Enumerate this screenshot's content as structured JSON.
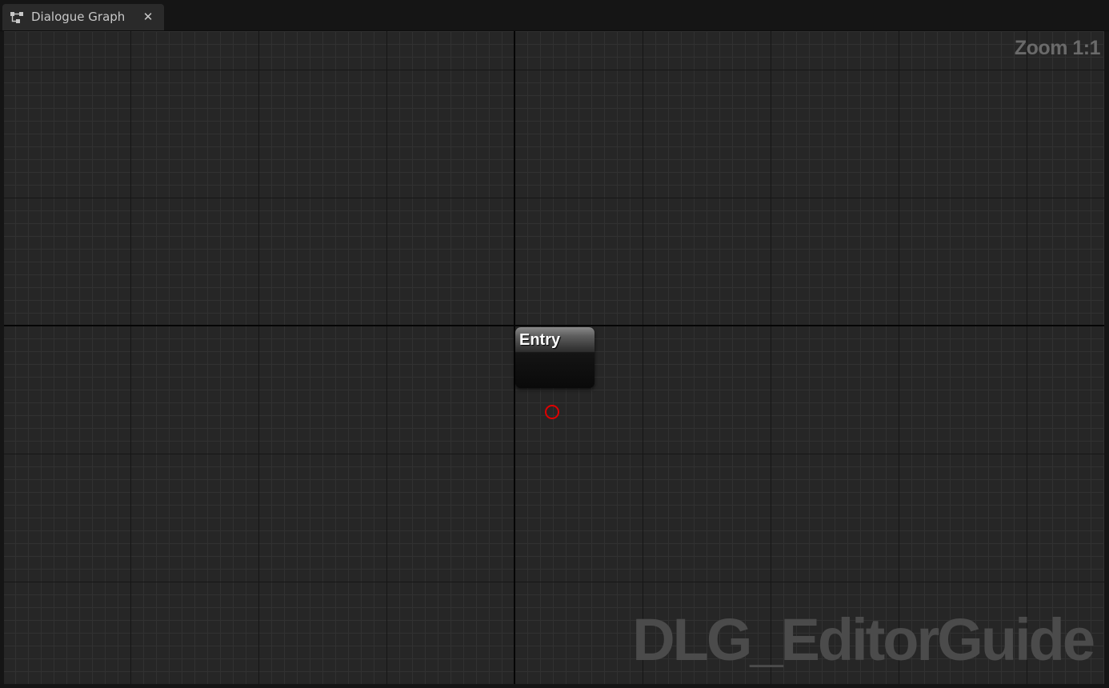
{
  "tab": {
    "label": "Dialogue Graph",
    "icon": "graph-icon",
    "close_glyph": "✕"
  },
  "graph": {
    "zoom_label": "Zoom 1:1",
    "watermark": "DLG_EditorGuide",
    "nodes": [
      {
        "title": "Entry",
        "output_pin_color": "#e00000"
      }
    ]
  },
  "colors": {
    "canvas_background": "#262626",
    "minor_grid": "#313131",
    "major_grid": "#161616",
    "origin_axis": "#050505",
    "tab_background": "#2a2a2a",
    "tabbar_background": "#151515",
    "pin_red": "#e00000"
  }
}
